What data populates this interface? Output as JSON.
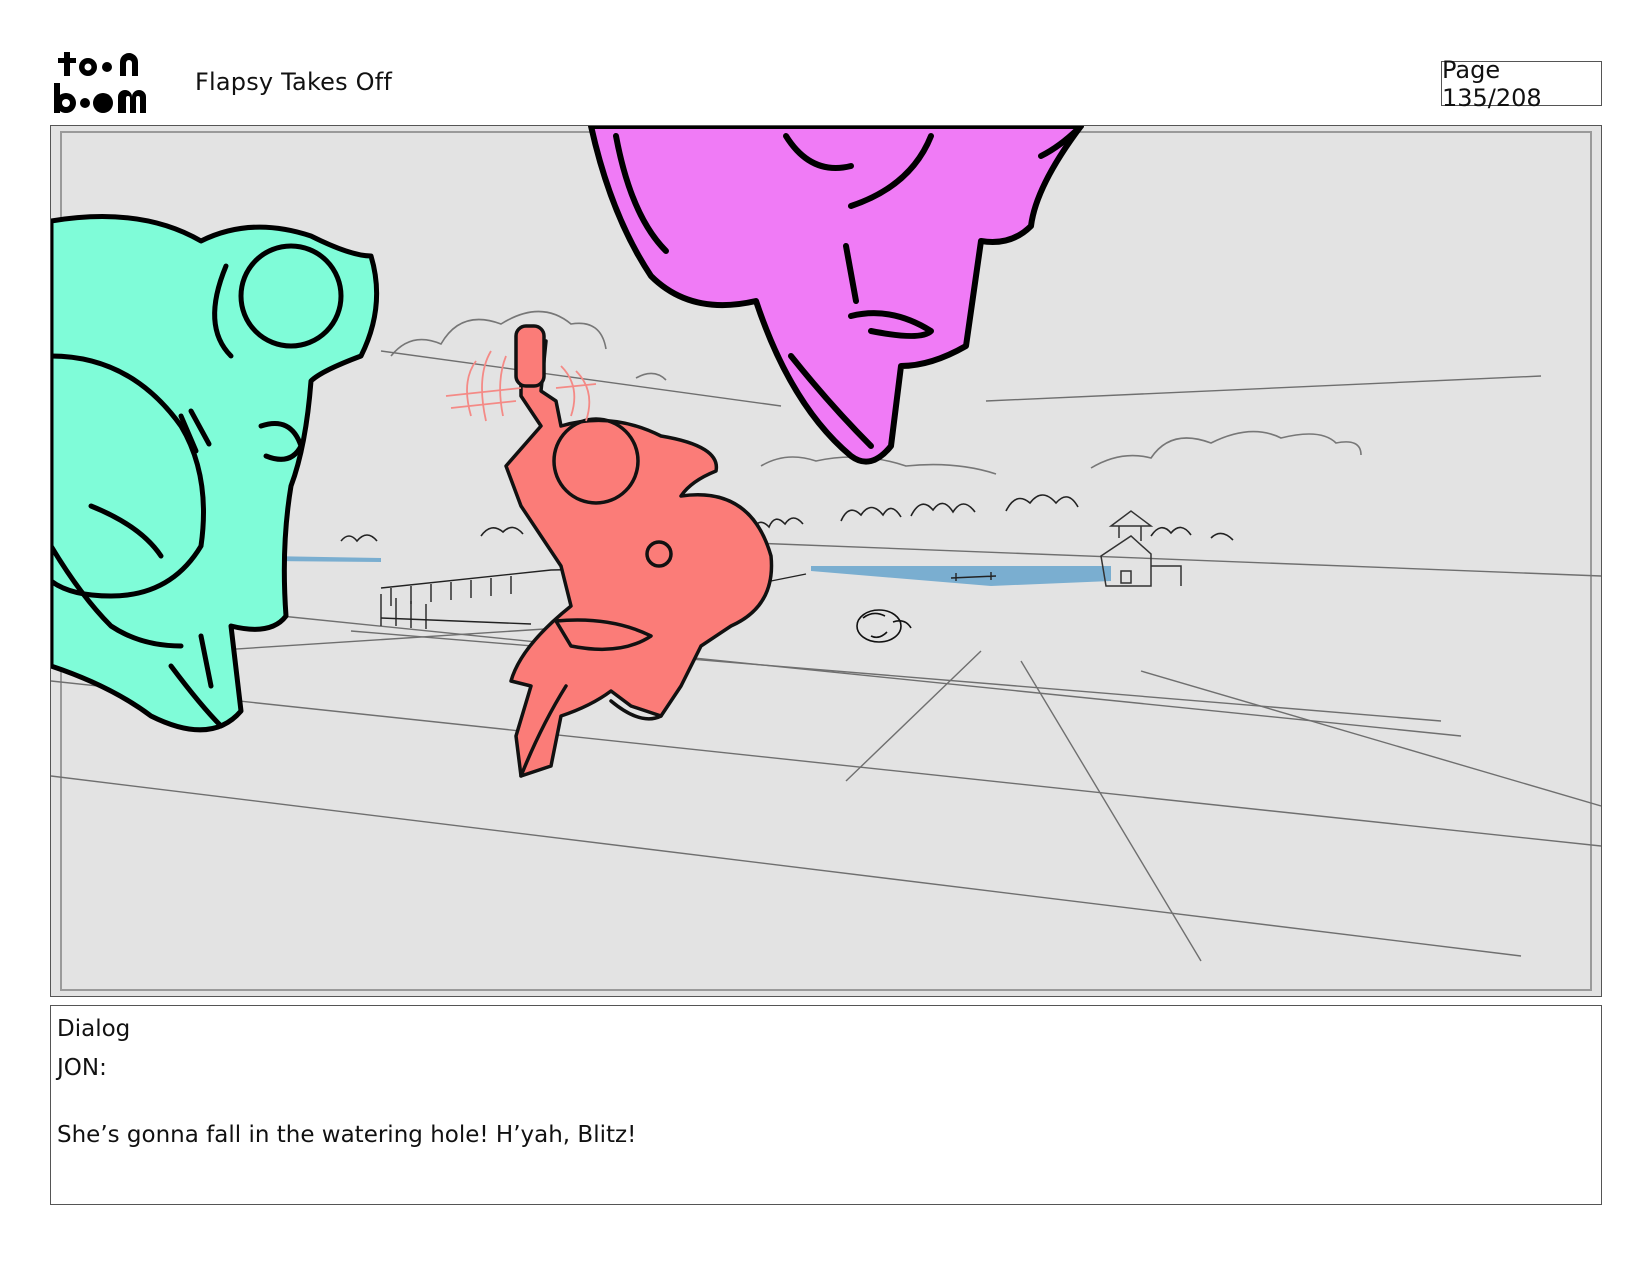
{
  "header": {
    "logo_text": "toonboom",
    "title": "Flapsy Takes Off",
    "page_label": "Page 135/208"
  },
  "panel": {
    "colors": {
      "background": "#e3e3e3",
      "teal_character": "#7ffcd8",
      "pink_character": "#f07bf6",
      "red_character": "#fb7c78",
      "water": "#7aaed0",
      "sketch_line": "#6f6f6f",
      "ink": "#000000"
    }
  },
  "dialog": {
    "heading": "Dialog",
    "speaker": "JON:",
    "line": "She’s gonna fall in the watering hole! H’yah, Blitz!"
  }
}
